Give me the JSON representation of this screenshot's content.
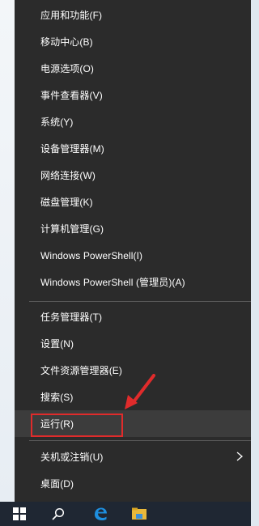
{
  "menu": {
    "items": [
      {
        "label": "应用和功能(F)"
      },
      {
        "label": "移动中心(B)"
      },
      {
        "label": "电源选项(O)"
      },
      {
        "label": "事件查看器(V)"
      },
      {
        "label": "系统(Y)"
      },
      {
        "label": "设备管理器(M)"
      },
      {
        "label": "网络连接(W)"
      },
      {
        "label": "磁盘管理(K)"
      },
      {
        "label": "计算机管理(G)"
      },
      {
        "label": "Windows PowerShell(I)"
      },
      {
        "label": "Windows PowerShell (管理员)(A)"
      },
      {
        "label": "任务管理器(T)"
      },
      {
        "label": "设置(N)"
      },
      {
        "label": "文件资源管理器(E)"
      },
      {
        "label": "搜索(S)"
      },
      {
        "label": "运行(R)"
      },
      {
        "label": "关机或注销(U)"
      },
      {
        "label": "桌面(D)"
      }
    ],
    "highlighted_item": "运行(R)"
  },
  "annotation_color": "#e02b2b",
  "taskbar": {
    "icons": [
      "windows-start-icon",
      "search-icon",
      "edge-browser-icon",
      "file-explorer-icon"
    ]
  }
}
